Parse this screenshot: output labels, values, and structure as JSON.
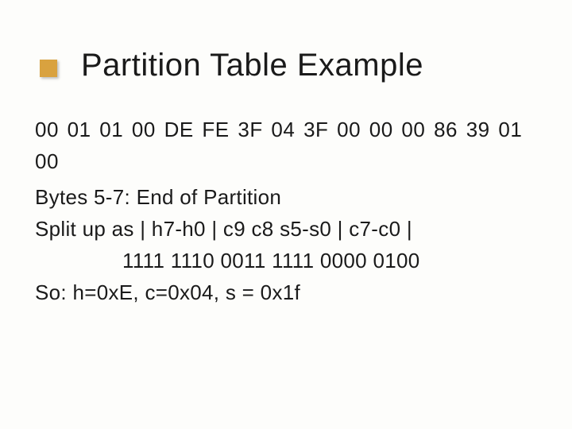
{
  "title": "Partition Table Example",
  "hex_row": "00 01 01 00  DE FE 3F 04  3F 00 00 00  86 39 01 00",
  "lines": {
    "l1": "Bytes 5-7: End of Partition",
    "l2": "Split up as | h7-h0 | c9 c8 s5-s0 | c7-c0 |",
    "l3": "1111 1110 0011 1111 0000 0100",
    "l4": "So: h=0xE, c=0x04, s = 0x1f"
  }
}
